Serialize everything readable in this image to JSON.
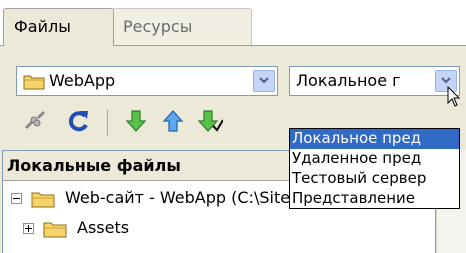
{
  "tabs": [
    {
      "label": "Файлы",
      "active": true
    },
    {
      "label": "Ресурсы",
      "active": false
    }
  ],
  "site_select": {
    "value": "WebApp",
    "icon": "folder-icon"
  },
  "view_select": {
    "value": "Локальное г"
  },
  "view_options": [
    {
      "label": "Локальное пред",
      "selected": true
    },
    {
      "label": "Удаленное пред",
      "selected": false
    },
    {
      "label": "Тестовый сервер",
      "selected": false
    },
    {
      "label": "Представление",
      "selected": false
    }
  ],
  "toolbar": {
    "items": [
      "connect-icon",
      "refresh-icon",
      "get-icon",
      "put-icon",
      "check-out-icon"
    ]
  },
  "file_panel": {
    "header": "Локальные файлы",
    "rows": [
      {
        "label": "Web-сайт - WebApp (C:\\Sites\\mo",
        "expanded": true,
        "icon": "folder-icon"
      },
      {
        "label": "Assets",
        "expanded": false,
        "icon": "folder-icon"
      }
    ]
  },
  "colors": {
    "panel_bg": "#ece9d8",
    "selection": "#316ac5",
    "arrow_green": "#3aa53a",
    "arrow_blue": "#2f7bd8",
    "refresh_blue": "#1f4fb4"
  }
}
